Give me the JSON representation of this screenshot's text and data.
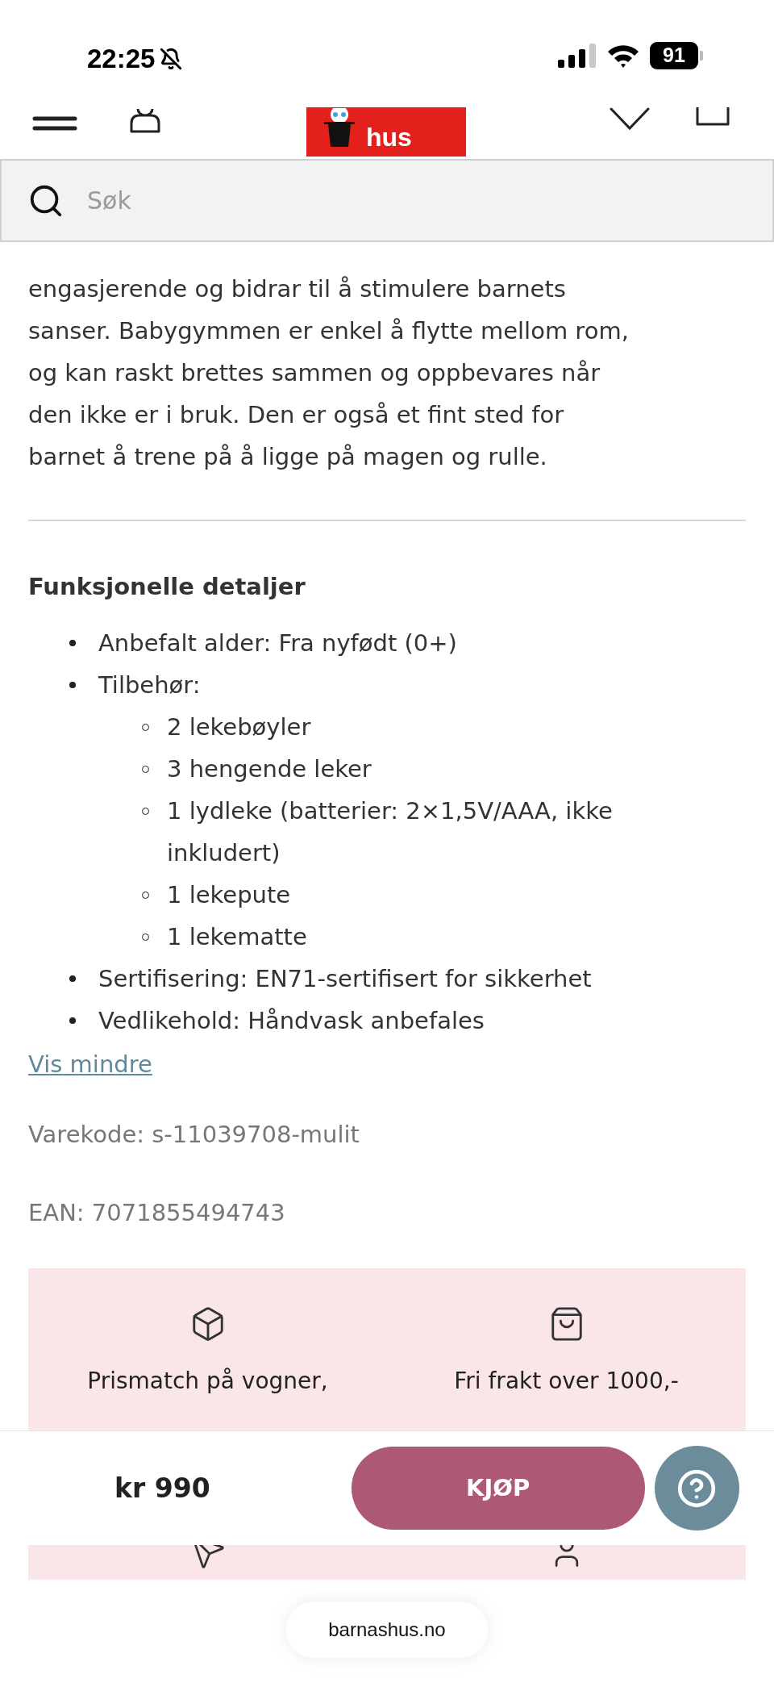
{
  "status_bar": {
    "time": "22:25",
    "battery": "91"
  },
  "header": {
    "logo_lines": [
      "hus"
    ]
  },
  "search": {
    "placeholder": "Søk"
  },
  "description": {
    "lines": [
      "engasjerende og bidrar til å stimulere barnets",
      "sanser. Babygymmen er enkel å flytte mellom rom,",
      "og kan raskt brettes sammen og oppbevares når",
      "den ikke er i bruk. Den er også et fint sted for",
      "barnet å trene på å ligge på magen og rulle."
    ]
  },
  "details": {
    "heading": "Funksjonelle detaljer",
    "items": [
      {
        "text": "Anbefalt alder: Fra nyfødt (0+)"
      },
      {
        "text": "Tilbehør:",
        "children": [
          {
            "text": "2 lekebøyler"
          },
          {
            "text": "3 hengende leker"
          },
          {
            "text": "1 lydleke (batterier: 2×1,5V/AAA, ikke inkludert)"
          },
          {
            "text": "1 lekepute"
          },
          {
            "text": "1 lekematte"
          }
        ]
      },
      {
        "text": "Sertifisering: EN71-sertifisert for sikkerhet"
      },
      {
        "text": "Vedlikehold: Håndvask anbefales"
      }
    ]
  },
  "toggle_link": "Vis mindre",
  "sku": "Varekode: s-11039708-mulit",
  "ean": "EAN: 7071855494743",
  "usps": [
    {
      "kind": "box",
      "text": "Prismatch på vogner,"
    },
    {
      "kind": "bag",
      "text": "Fri frakt over 1000,-"
    }
  ],
  "buy_bar": {
    "price": "kr 990",
    "button": "KJØP"
  },
  "browser": {
    "url": "barnashus.no"
  }
}
